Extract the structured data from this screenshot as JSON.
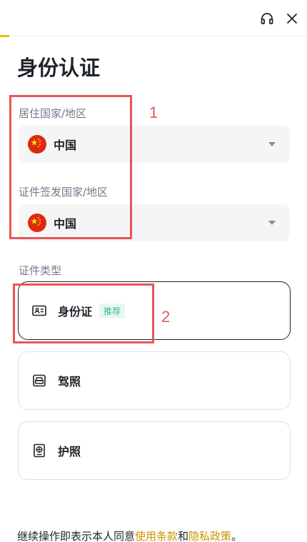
{
  "header": {
    "support_icon": "headset-icon",
    "close_icon": "close-icon",
    "progress_percent": 3,
    "accent_color": "#f0b90b"
  },
  "page": {
    "title": "身份认证"
  },
  "residence": {
    "label": "居住国家/地区",
    "value": "中国",
    "flag_icon": "china-flag-icon"
  },
  "issuing": {
    "label": "证件签发国家/地区",
    "value": "中国",
    "flag_icon": "china-flag-icon"
  },
  "document_type": {
    "label": "证件类型",
    "options": [
      {
        "label": "身份证",
        "badge": "推荐",
        "icon": "id-card-icon",
        "selected": true
      },
      {
        "label": "驾照",
        "icon": "driver-license-icon",
        "selected": false
      },
      {
        "label": "护照",
        "icon": "passport-icon",
        "selected": false
      }
    ]
  },
  "annotations": [
    {
      "number": "1",
      "color": "#e85656"
    },
    {
      "number": "2",
      "color": "#e85656"
    }
  ],
  "footer": {
    "prefix": "继续操作即表示本人同意",
    "terms_link": "使用条款",
    "conjunction": "和",
    "privacy_link": "隐私政策",
    "suffix": "。",
    "link_color": "#c99400"
  }
}
